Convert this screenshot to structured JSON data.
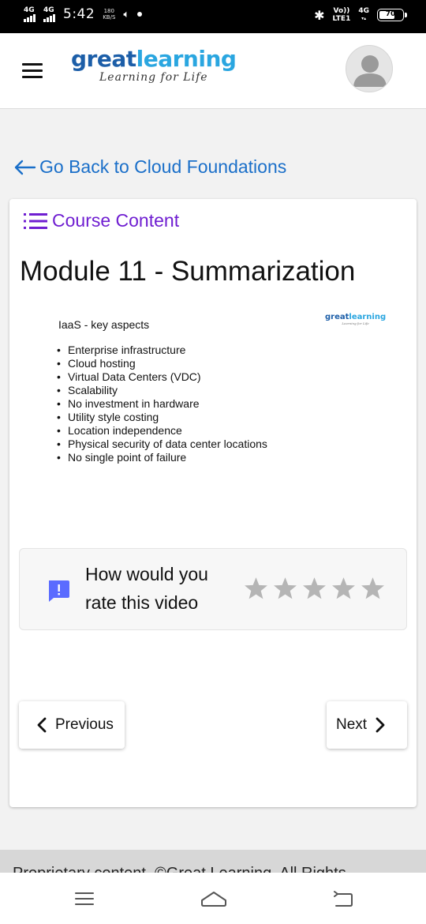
{
  "status_bar": {
    "sim1": "4G",
    "sim2": "4G",
    "time": "5:42",
    "speed_value": "180",
    "speed_unit": "KB/S",
    "volte": "Vo))",
    "lte": "LTE1",
    "network2": "4G",
    "battery": "70"
  },
  "header": {
    "brand_part1": "great",
    "brand_part2": "learning",
    "tagline": "Learning for Life"
  },
  "back_link": "Go Back to Cloud Foundations",
  "course_content_label": "Course Content",
  "module_title": "Module 11 - Summarization",
  "slide": {
    "heading": "IaaS - key aspects",
    "logo_part1": "great",
    "logo_part2": "learning",
    "logo_tagline": "Learning for Life",
    "bullets": [
      "Enterprise infrastructure",
      "Cloud hosting",
      "Virtual Data Centers (VDC)",
      "Scalability",
      "No investment in hardware",
      "Utility style costing",
      "Location independence",
      "Physical security of data center locations",
      "No single point of failure"
    ]
  },
  "rating": {
    "prompt": "How would you rate this video",
    "max_stars": 5,
    "selected_stars": 0
  },
  "navigation": {
    "previous_label": "Previous",
    "next_label": "Next"
  },
  "footer_text": "Proprietary content. ©Great Learning. All Rights",
  "icons": {
    "menu": "hamburger-icon",
    "back": "arrow-left-icon",
    "course_content": "list-icon",
    "feedback": "feedback-icon",
    "star": "star-icon",
    "prev": "chevron-left-icon",
    "next": "chevron-right-icon"
  },
  "colors": {
    "brand_dark": "#1c5ea8",
    "brand_light": "#2aa6e0",
    "link_blue": "#1a6fc9",
    "course_purple": "#6f1ed1",
    "feedback_blue": "#5a6bff",
    "star_grey": "#b5b5b5"
  }
}
